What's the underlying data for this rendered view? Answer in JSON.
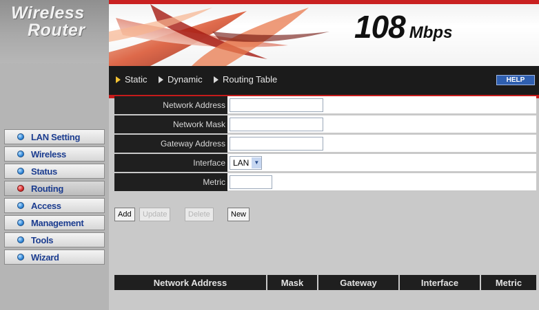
{
  "brand": {
    "line1": "Wireless",
    "line2": "Router"
  },
  "banner": {
    "speed_number": "108",
    "speed_unit": "Mbps"
  },
  "tabs": [
    {
      "label": "Static",
      "active": true
    },
    {
      "label": "Dynamic",
      "active": false
    },
    {
      "label": "Routing Table",
      "active": false
    }
  ],
  "help_label": "HELP",
  "nav": [
    {
      "label": "LAN Setting"
    },
    {
      "label": "Wireless"
    },
    {
      "label": "Status"
    },
    {
      "label": "Routing",
      "active": true
    },
    {
      "label": "Access"
    },
    {
      "label": "Management"
    },
    {
      "label": "Tools"
    },
    {
      "label": "Wizard"
    }
  ],
  "form": {
    "network_address": {
      "label": "Network Address",
      "value": ""
    },
    "network_mask": {
      "label": "Network Mask",
      "value": ""
    },
    "gateway_address": {
      "label": "Gateway Address",
      "value": ""
    },
    "interface": {
      "label": "Interface",
      "value": "LAN"
    },
    "metric": {
      "label": "Metric",
      "value": ""
    }
  },
  "buttons": {
    "add": "Add",
    "update": "Update",
    "delete": "Delete",
    "new": "New"
  },
  "table": {
    "columns": [
      "Network Address",
      "Mask",
      "Gateway",
      "Interface",
      "Metric"
    ]
  },
  "colors": {
    "accent_red": "#c61b1b",
    "header_black": "#1b1b1b",
    "nav_text": "#1b3c8f"
  }
}
